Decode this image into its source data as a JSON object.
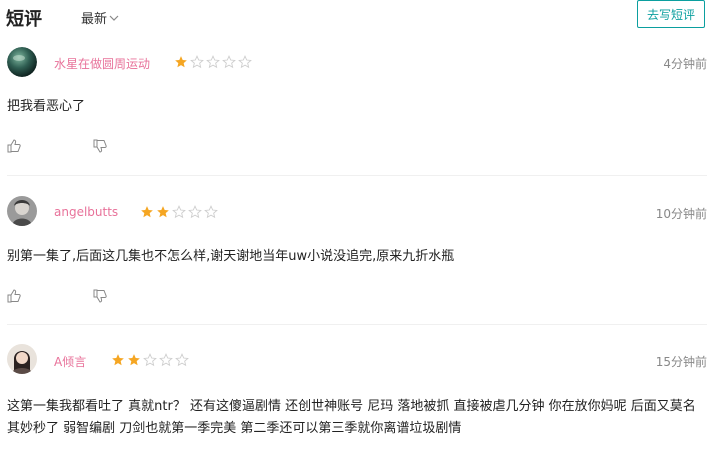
{
  "header": {
    "title": "短评",
    "sort_label": "最新",
    "write_button": "去写短评"
  },
  "comments": [
    {
      "username": "水星在做圆周运动",
      "rating": 1,
      "max_rating": 5,
      "time": "4分钟前",
      "text": "把我看恶心了",
      "avatar_icon": "planet-avatar"
    },
    {
      "username": "angelbutts",
      "rating": 2,
      "max_rating": 5,
      "time": "10分钟前",
      "text": "别第一集了,后面这几集也不怎么样,谢天谢地当年uw小说没追完,原来九折水瓶",
      "avatar_icon": "character-avatar"
    },
    {
      "username": "A倾言",
      "rating": 2,
      "max_rating": 5,
      "time": "15分钟前",
      "text": "这第一集我都看吐了 真就ntr？ 还有这傻逼剧情 还创世神账号 尼玛 落地被抓 直接被虐几分钟 你在放你妈呢 后面又莫名其妙秒了 弱智编剧 刀剑也就第一季完美 第二季还可以第三季就你离谱垃圾剧情",
      "avatar_icon": "person-avatar"
    }
  ],
  "colors": {
    "accent": "#0b9f9f",
    "username": "#e8729a",
    "star_filled": "#f5a623",
    "star_empty": "#cccccc"
  }
}
